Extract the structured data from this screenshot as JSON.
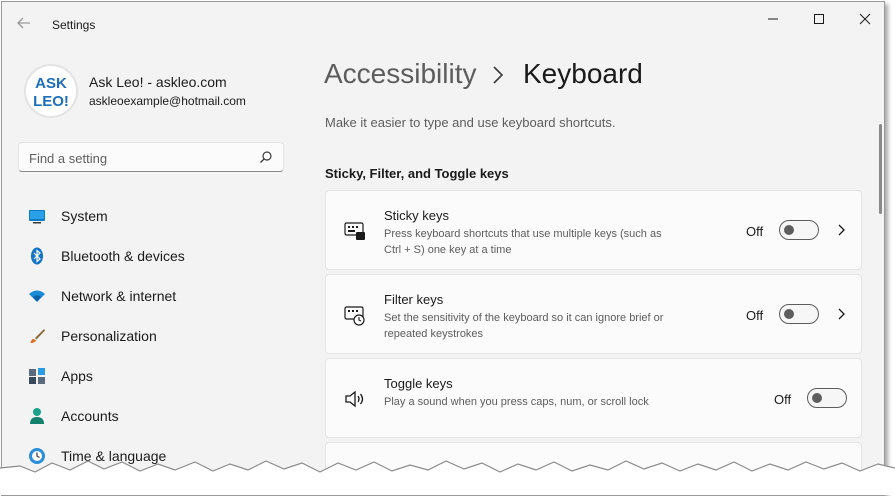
{
  "window": {
    "title": "Settings",
    "controls": [
      "minimize-icon",
      "maximize-icon",
      "close-icon"
    ]
  },
  "user": {
    "avatar_text_line1": "ASK",
    "avatar_text_line2": "LEO!",
    "name": "Ask Leo! - askleo.com",
    "email": "askleoexample@hotmail.com"
  },
  "search": {
    "placeholder": "Find a setting",
    "icon": "search-icon"
  },
  "sidebar": {
    "items": [
      {
        "label": "System",
        "icon": "monitor-icon"
      },
      {
        "label": "Bluetooth & devices",
        "icon": "bluetooth-icon"
      },
      {
        "label": "Network & internet",
        "icon": "wifi-icon"
      },
      {
        "label": "Personalization",
        "icon": "brush-icon"
      },
      {
        "label": "Apps",
        "icon": "apps-icon"
      },
      {
        "label": "Accounts",
        "icon": "person-icon"
      },
      {
        "label": "Time & language",
        "icon": "clock-globe-icon"
      }
    ]
  },
  "header": {
    "parent": "Accessibility",
    "current": "Keyboard"
  },
  "subtitle": "Make it easier to type and use keyboard shortcuts.",
  "section_title": "Sticky, Filter, and Toggle keys",
  "settings": [
    {
      "title": "Sticky keys",
      "desc": "Press keyboard shortcuts that use multiple keys (such as Ctrl + S) one key at a time",
      "state": "Off",
      "has_chevron": true,
      "icon": "sticky-keys-icon"
    },
    {
      "title": "Filter keys",
      "desc": "Set the sensitivity of the keyboard so it can ignore brief or repeated keystrokes",
      "state": "Off",
      "has_chevron": true,
      "icon": "filter-keys-icon"
    },
    {
      "title": "Toggle keys",
      "desc": "Play a sound when you press caps, num, or scroll lock",
      "state": "Off",
      "has_chevron": false,
      "icon": "speaker-icon"
    }
  ],
  "colors": {
    "window_bg": "#f3f3f3",
    "card_bg": "#fbfbfb",
    "accent_blue": "#0067c0"
  }
}
